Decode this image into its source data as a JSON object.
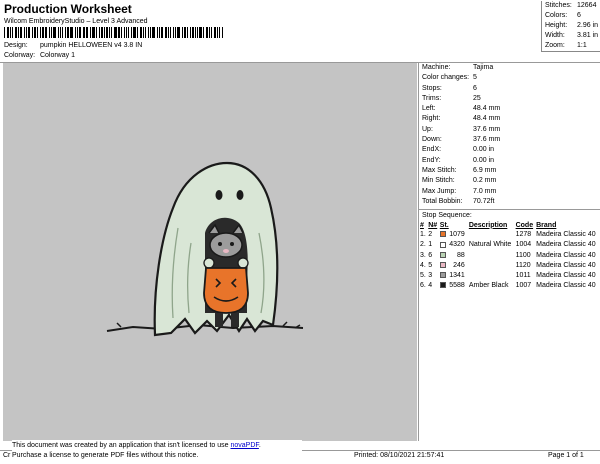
{
  "header": {
    "title": "Production Worksheet",
    "subtitle": "Wilcom EmbroideryStudio – Level 3 Advanced",
    "design_label": "Design:",
    "design_value": "pumpkin HELLOWEEN v4 3.8 IN",
    "colorway_label": "Colorway:",
    "colorway_value": "Colorway 1"
  },
  "top_stats": [
    {
      "label": "Stitches:",
      "value": "12664"
    },
    {
      "label": "Colors:",
      "value": "6"
    },
    {
      "label": "Height:",
      "value": "2.96 in"
    },
    {
      "label": "Width:",
      "value": "3.81 in"
    },
    {
      "label": "Zoom:",
      "value": "1:1"
    }
  ],
  "properties": [
    {
      "label": "Machine:",
      "value": "Tajima"
    },
    {
      "label": "Color changes:",
      "value": "5"
    },
    {
      "label": "Stops:",
      "value": "6"
    },
    {
      "label": "Trims:",
      "value": "25"
    },
    {
      "label": "Left:",
      "value": "48.4 mm"
    },
    {
      "label": "Right:",
      "value": "48.4 mm"
    },
    {
      "label": "Up:",
      "value": "37.6 mm"
    },
    {
      "label": "Down:",
      "value": "37.6 mm"
    },
    {
      "label": "EndX:",
      "value": "0.00 in"
    },
    {
      "label": "EndY:",
      "value": "0.00 in"
    },
    {
      "label": "Max Stitch:",
      "value": "6.9 mm"
    },
    {
      "label": "Min Stitch:",
      "value": "0.2 mm"
    },
    {
      "label": "Max Jump:",
      "value": "7.0 mm"
    },
    {
      "label": "Total Bobbin:",
      "value": "70.72ft"
    }
  ],
  "stop_sequence": {
    "title": "Stop Sequence:",
    "columns": [
      "#",
      "N#",
      "St.",
      "Description",
      "Code",
      "Brand"
    ],
    "rows": [
      {
        "num": "1.",
        "n": "2",
        "swatch": "#e8742a",
        "st": "1079",
        "desc": "",
        "code": "1278",
        "brand": "Madeira Classic 40"
      },
      {
        "num": "2.",
        "n": "1",
        "swatch": "#ffffff",
        "st": "4320",
        "desc": "Natural White",
        "code": "1004",
        "brand": "Madeira Classic 40"
      },
      {
        "num": "3.",
        "n": "6",
        "swatch": "#b9d3b4",
        "st": "88",
        "desc": "",
        "code": "1100",
        "brand": "Madeira Classic 40"
      },
      {
        "num": "4.",
        "n": "5",
        "swatch": "#e9b8c4",
        "st": "246",
        "desc": "",
        "code": "1120",
        "brand": "Madeira Classic 40"
      },
      {
        "num": "5.",
        "n": "3",
        "swatch": "#9c9c9c",
        "st": "1341",
        "desc": "",
        "code": "1011",
        "brand": "Madeira Classic 40"
      },
      {
        "num": "6.",
        "n": "4",
        "swatch": "#1a1a1a",
        "st": "5588",
        "desc": "Amber Black",
        "code": "1007",
        "brand": "Madeira Classic 40"
      }
    ]
  },
  "colors": {
    "design_bg": "#c4c4c4",
    "ghost_fill": "#d9e6d6",
    "outline": "#1a1a1a",
    "pumpkin": "#e8742a"
  },
  "notice": {
    "line1_prefix": "This document was created by an application that isn't licensed to use ",
    "link": "novaPDF",
    "line1_suffix": ".",
    "line2": "Purchase a license to generate PDF files without this notice."
  },
  "footer": {
    "cr": "Cr",
    "printed": "Printed: 08/10/2021 21:57:41",
    "page": "Page 1 of 1"
  }
}
